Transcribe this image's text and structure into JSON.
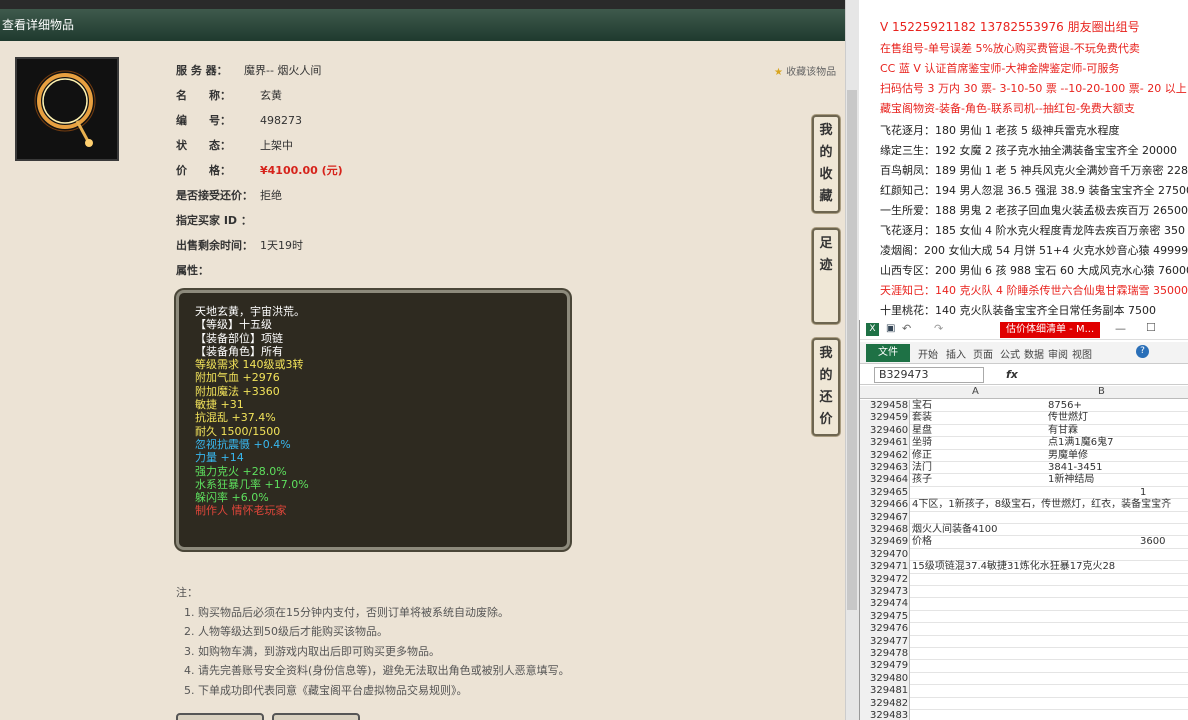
{
  "title_bar": "查看详细物品",
  "fields": [
    {
      "label": "服 务 器：",
      "value": "魔界-- 烟火人间"
    },
    {
      "label": "名　　称：",
      "value": "玄黄"
    },
    {
      "label": "编　　号：",
      "value": "498273"
    },
    {
      "label": "状　　态：",
      "value": "上架中"
    },
    {
      "label": "价　　格：",
      "value": "¥4100.00 (元)"
    },
    {
      "label": "是否接受还价：",
      "value": "拒绝"
    },
    {
      "label": "指定买家 ID ：",
      "value": ""
    },
    {
      "label": "出售剩余时间：",
      "value": "1天19时"
    },
    {
      "label": "属性：",
      "value": ""
    }
  ],
  "favorite_link": "收藏该物品",
  "attributes": [
    {
      "text": "天地玄黄，宇宙洪荒。",
      "color": "#ffffff"
    },
    {
      "text": "【等级】十五级",
      "color": "#ffffff"
    },
    {
      "text": "【装备部位】项链",
      "color": "#ffffff"
    },
    {
      "text": "【装备角色】所有",
      "color": "#ffffff"
    },
    {
      "text": "等级需求 140级或3转",
      "color": "#f2e35a"
    },
    {
      "text": "附加气血 +2976",
      "color": "#f2e35a"
    },
    {
      "text": "附加魔法 +3360",
      "color": "#f2e35a"
    },
    {
      "text": "敏捷 +31",
      "color": "#f2e35a"
    },
    {
      "text": "抗混乱 +37.4%",
      "color": "#f2e35a"
    },
    {
      "text": "耐久 1500/1500",
      "color": "#f2e35a"
    },
    {
      "text": "忽视抗震慑 +0.4%",
      "color": "#38b8f0"
    },
    {
      "text": "力量 +14",
      "color": "#38b8f0"
    },
    {
      "text": "强力克火 +28.0%",
      "color": "#5ee05e"
    },
    {
      "text": "水系狂暴几率 +17.0%",
      "color": "#5ee05e"
    },
    {
      "text": "躲闪率 +6.0%",
      "color": "#5ee05e"
    },
    {
      "text": "制作人 情怀老玩家",
      "color": "#e0463a"
    }
  ],
  "notes": {
    "heading": "注：",
    "items": [
      "1. 购买物品后必须在15分钟内支付，否则订单将被系统自动废除。",
      "2. 人物等级达到50级后才能购买该物品。",
      "3. 如购物车满，到游戏内取出后即可购买更多物品。",
      "4. 请先完善账号安全资料(身份信息等)，避免无法取出角色或被别人恶意填写。",
      "5. 下单成功即代表同意《藏宝阁平台虚拟物品交易规则》。"
    ]
  },
  "side_tabs": [
    "我的收藏",
    "足迹",
    "我的还价"
  ],
  "right_text": [
    {
      "text": "V 15225921182   13782553976 朋友圈出组号",
      "color": "#e8231e"
    },
    {
      "text": "在售组号-单号误差 5%放心购买费管退-不玩免费代卖",
      "color": "#e8231e"
    },
    {
      "text": "CC 蓝 V 认证首席鉴宝师-大神金牌鉴定师-可服务",
      "color": "#e8231e"
    },
    {
      "text": "扫码估号 3 万内 30 票- 3-10-50 票 --10-20-100 票- 20 以上 150",
      "color": "#e8231e"
    },
    {
      "text": "藏宝阁物资-装备-角色-联系司机--抽红包-免费大额支",
      "color": "#e8231e"
    },
    {
      "text": "飞花逐月：180 男仙 1 老孩 5 级神兵雷克水程度",
      "color": "#222222"
    },
    {
      "text": "缘定三生：192 女魔 2 孩子克水抽全满装备宝宝齐全 20000",
      "color": "#222222"
    },
    {
      "text": "百鸟朝凤：189 男仙 1 老 5 神兵风克火全满妙音千万亲密 228",
      "color": "#222222"
    },
    {
      "text": "红颜知己：194 男人忽混 36.5 强混 38.9 装备宝宝齐全 27500",
      "color": "#222222"
    },
    {
      "text": "一生所爱：188 男鬼 2 老孩子回血鬼火装孟极去疾百万 26500",
      "color": "#222222"
    },
    {
      "text": "飞花逐月：185 女仙 4 阶水克火程度青龙阵去疾百万亲密 350",
      "color": "#222222"
    },
    {
      "text": "凌烟阁：200 女仙大成 54 月饼 51+4 火克水妙音心猿 49999",
      "color": "#222222"
    },
    {
      "text": "山西专区：200 男仙 6 孩 988 宝石 60 大成风克水心猿 76000",
      "color": "#222222"
    },
    {
      "text": "天涯知己：140 克火队 4 阶睡杀传世六合仙鬼甘霖瑞雪 35000",
      "color": "#e8231e"
    },
    {
      "text": "十里桃花：140 克火队装备宝宝齐全日常任务副本 7500",
      "color": "#222222"
    }
  ],
  "excel": {
    "window_title": "估价体细清单 - M...",
    "file_tab": "文件",
    "ribbon_tabs": [
      "开始",
      "插入",
      "页面",
      "公式",
      "数据",
      "审阅",
      "视图"
    ],
    "namebox": "B329473",
    "fx": "fx",
    "col_a": "A",
    "col_b": "B",
    "rows": [
      {
        "n": "329458",
        "a": "宝石",
        "b": "8756+"
      },
      {
        "n": "329459",
        "a": "套装",
        "b": "传世燃灯"
      },
      {
        "n": "329460",
        "a": "星盘",
        "b": "有甘霖"
      },
      {
        "n": "329461",
        "a": "坐骑",
        "b": "点1满1魔6鬼7"
      },
      {
        "n": "329462",
        "a": "修正",
        "b": "男魔单修"
      },
      {
        "n": "329463",
        "a": "法门",
        "b": "3841-3451"
      },
      {
        "n": "329464",
        "a": "孩子",
        "b": "1新神结局"
      },
      {
        "n": "329465",
        "a": "",
        "b": "1"
      },
      {
        "n": "329466",
        "a": "4下区，1新孩子，8级宝石，传世燃灯，红衣，装备宝宝齐",
        "b": ""
      },
      {
        "n": "329467",
        "a": "",
        "b": ""
      },
      {
        "n": "329468",
        "a": "烟火人间装备4100",
        "b": ""
      },
      {
        "n": "329469",
        "a": "价格",
        "b": "3600"
      },
      {
        "n": "329470",
        "a": "",
        "b": ""
      },
      {
        "n": "329471",
        "a": "15级项链混37.4敏捷31炼化水狂暴17克火28",
        "b": ""
      },
      {
        "n": "329472",
        "a": "",
        "b": ""
      },
      {
        "n": "329473",
        "a": "",
        "b": ""
      },
      {
        "n": "329474",
        "a": "",
        "b": ""
      },
      {
        "n": "329475",
        "a": "",
        "b": ""
      },
      {
        "n": "329476",
        "a": "",
        "b": ""
      },
      {
        "n": "329477",
        "a": "",
        "b": ""
      },
      {
        "n": "329478",
        "a": "",
        "b": ""
      },
      {
        "n": "329479",
        "a": "",
        "b": ""
      },
      {
        "n": "329480",
        "a": "",
        "b": ""
      },
      {
        "n": "329481",
        "a": "",
        "b": ""
      },
      {
        "n": "329482",
        "a": "",
        "b": ""
      },
      {
        "n": "329483",
        "a": "",
        "b": ""
      }
    ]
  },
  "colors": {
    "price_red": "#d6231b",
    "title_bar": "#2e4a3c",
    "excel_green": "#1e7145"
  }
}
